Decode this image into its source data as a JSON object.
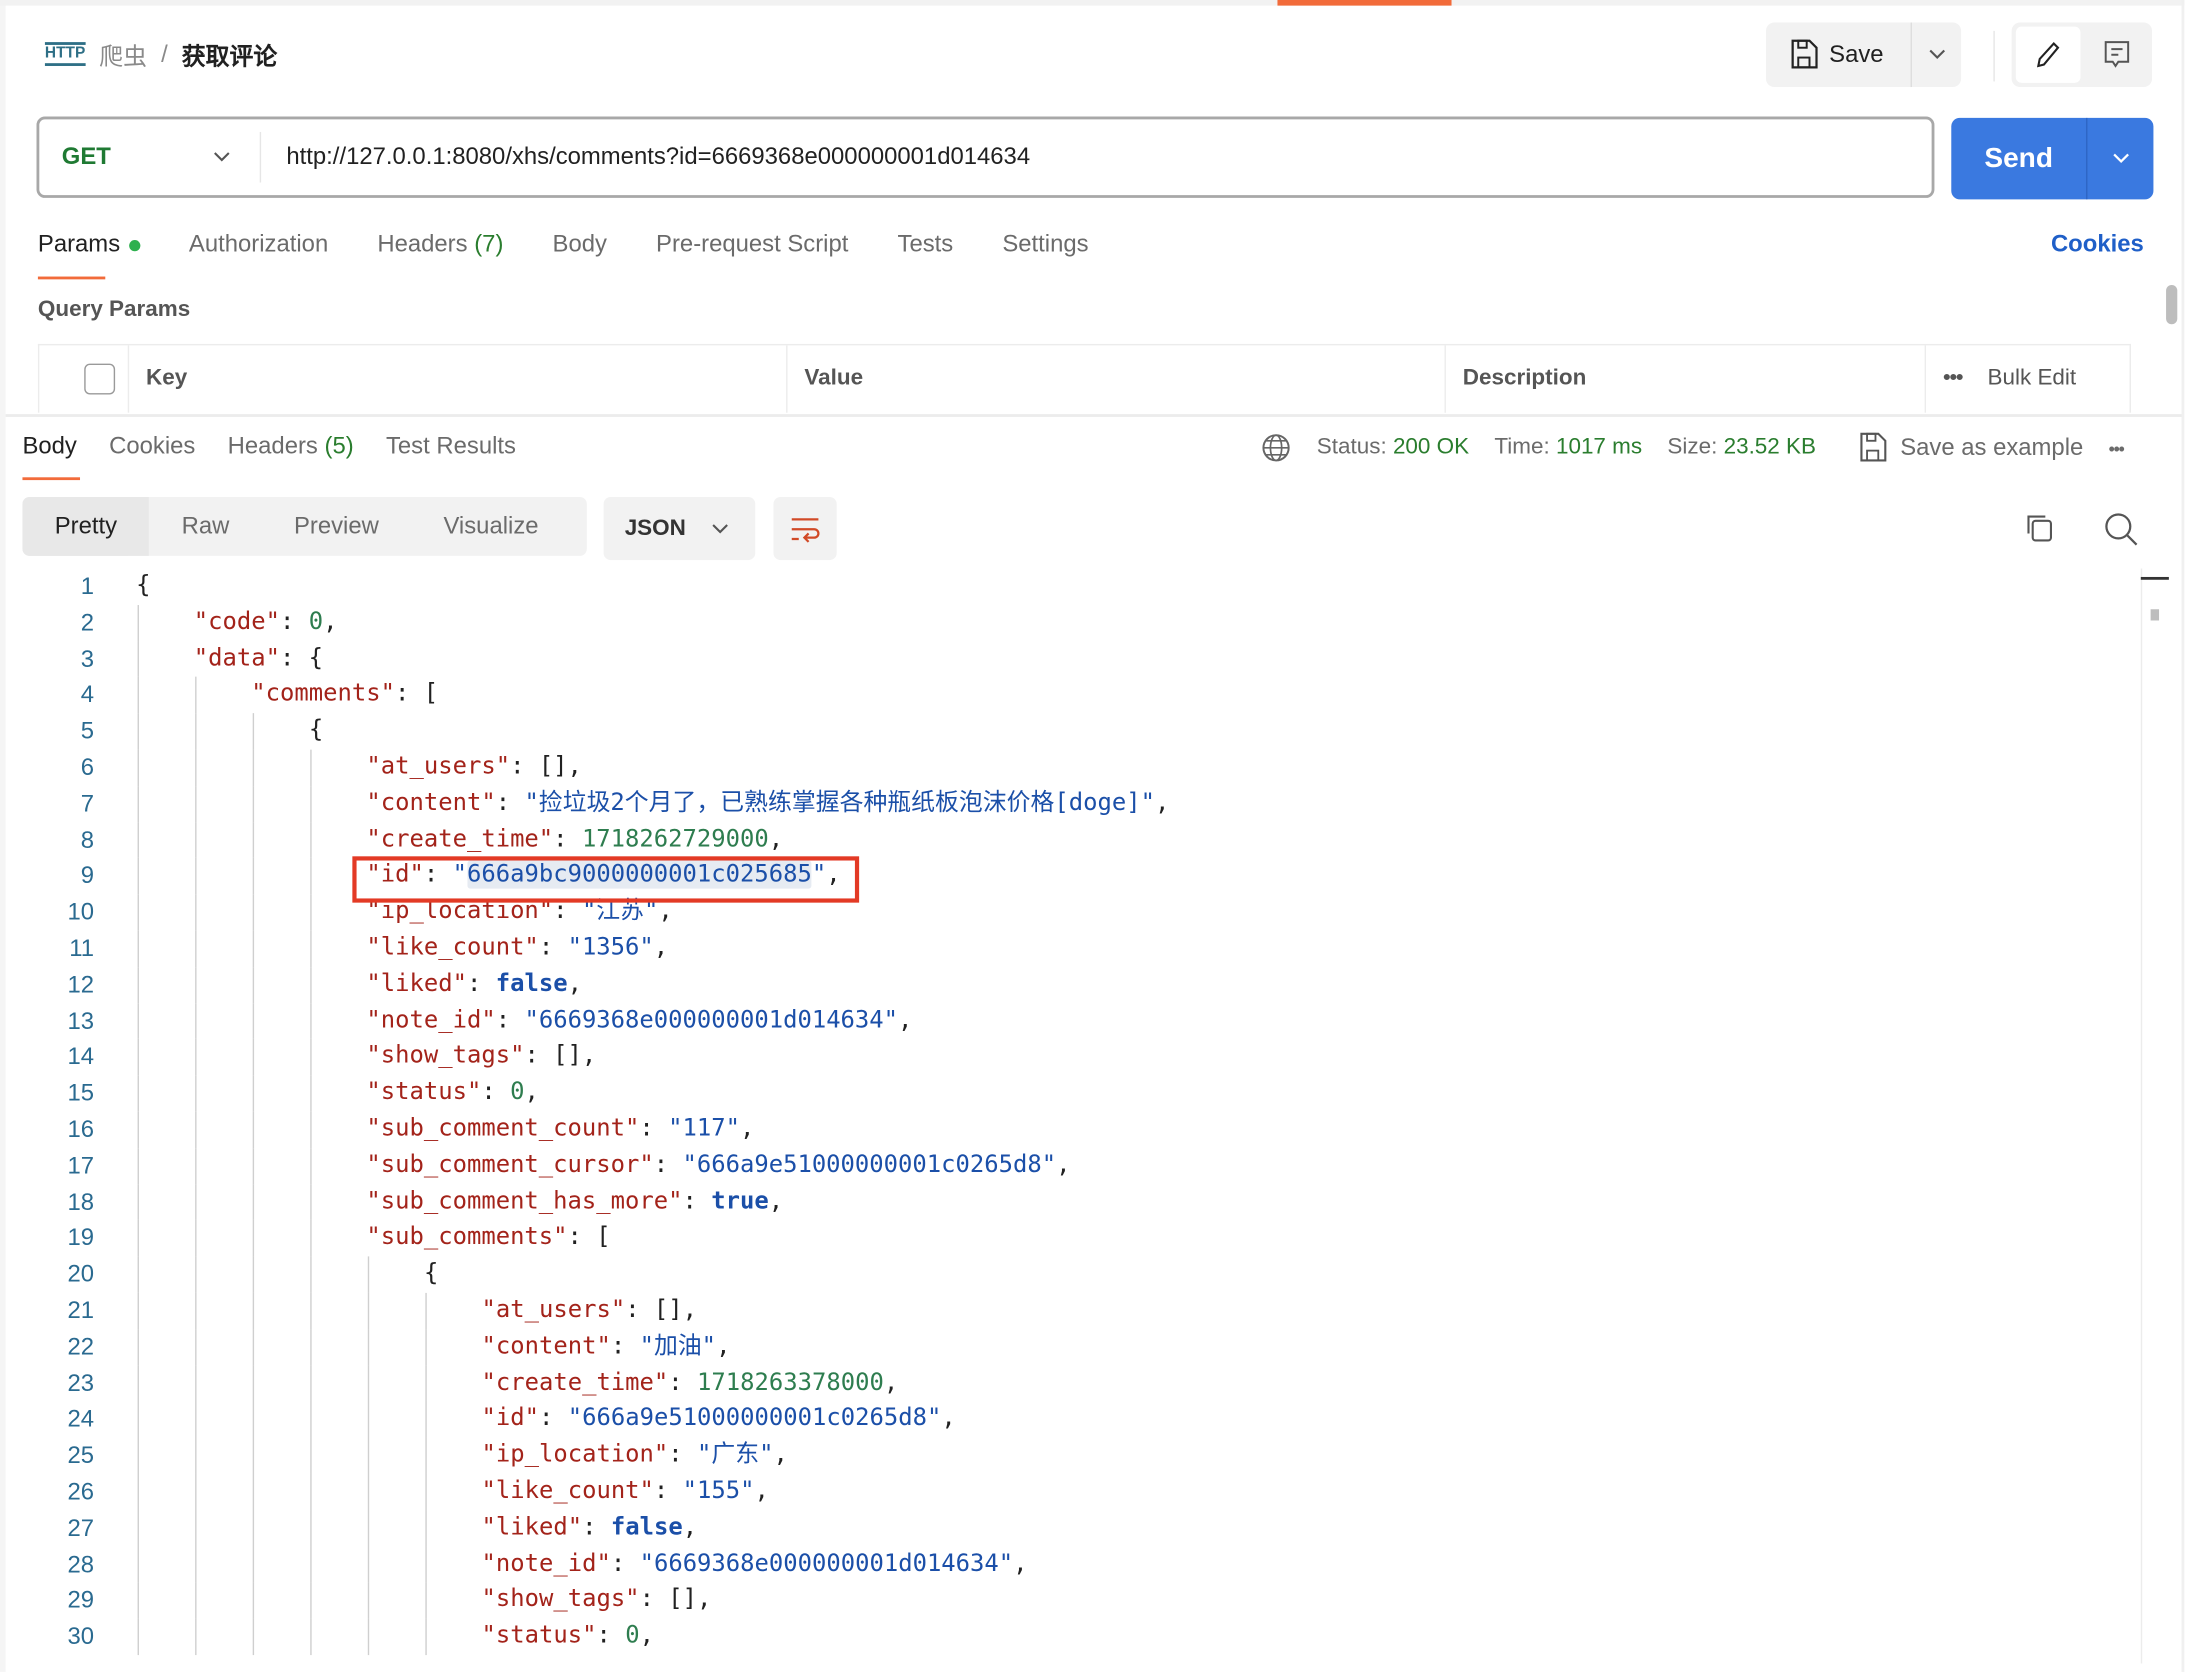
{
  "breadcrumb": {
    "type_icon": "HTTP",
    "collection": "爬虫",
    "separator": "/",
    "request": "获取评论"
  },
  "toolbar": {
    "save_label": "Save"
  },
  "request": {
    "method": "GET",
    "url": "http://127.0.0.1:8080/xhs/comments?id=6669368e000000001d014634",
    "send_label": "Send"
  },
  "request_tabs": [
    {
      "label": "Params",
      "active": true
    },
    {
      "label": "Authorization"
    },
    {
      "label": "Headers",
      "count": "(7)"
    },
    {
      "label": "Body"
    },
    {
      "label": "Pre-request Script"
    },
    {
      "label": "Tests"
    },
    {
      "label": "Settings"
    }
  ],
  "cookies_link": "Cookies",
  "query_params": {
    "title": "Query Params",
    "columns": [
      "Key",
      "Value",
      "Description"
    ],
    "bulk_edit": "Bulk Edit"
  },
  "response_tabs": [
    {
      "label": "Body",
      "active": true
    },
    {
      "label": "Cookies"
    },
    {
      "label": "Headers",
      "count": "(5)"
    },
    {
      "label": "Test Results"
    }
  ],
  "response_meta": {
    "status_label": "Status:",
    "status": "200 OK",
    "time_label": "Time:",
    "time": "1017 ms",
    "size_label": "Size:",
    "size": "23.52 KB",
    "save_example": "Save as example"
  },
  "view_modes": [
    "Pretty",
    "Raw",
    "Preview",
    "Visualize"
  ],
  "format": "JSON",
  "colors": {
    "accent": "#f26b3a",
    "send": "#3a79e0",
    "highlight_box": "#e33a25",
    "key": "#a3231a",
    "string": "#1b4fa8",
    "number": "#2e7d4f"
  },
  "code_lines": [
    {
      "indent": 0,
      "tokens": [
        [
          "p",
          "{"
        ]
      ]
    },
    {
      "indent": 1,
      "tokens": [
        [
          "k",
          "\"code\""
        ],
        [
          "p",
          ": "
        ],
        [
          "n",
          "0"
        ],
        [
          "p",
          ","
        ]
      ]
    },
    {
      "indent": 1,
      "tokens": [
        [
          "k",
          "\"data\""
        ],
        [
          "p",
          ": {"
        ]
      ]
    },
    {
      "indent": 2,
      "tokens": [
        [
          "k",
          "\"comments\""
        ],
        [
          "p",
          ": ["
        ]
      ]
    },
    {
      "indent": 3,
      "tokens": [
        [
          "p",
          "{"
        ]
      ]
    },
    {
      "indent": 4,
      "tokens": [
        [
          "k",
          "\"at_users\""
        ],
        [
          "p",
          ": [],"
        ]
      ]
    },
    {
      "indent": 4,
      "tokens": [
        [
          "k",
          "\"content\""
        ],
        [
          "p",
          ": "
        ],
        [
          "s",
          "\"捡垃圾2个月了，已熟练掌握各种瓶纸板泡沫价格[doge]\""
        ],
        [
          "p",
          ","
        ]
      ]
    },
    {
      "indent": 4,
      "tokens": [
        [
          "k",
          "\"create_time\""
        ],
        [
          "p",
          ": "
        ],
        [
          "n",
          "1718262729000"
        ],
        [
          "p",
          ","
        ]
      ]
    },
    {
      "indent": 4,
      "highlighted": true,
      "tokens": [
        [
          "k",
          "\"id\""
        ],
        [
          "p",
          ": "
        ],
        [
          "s",
          "\""
        ],
        [
          "sel",
          "666a9bc9000000001c025685"
        ],
        [
          "s",
          "\""
        ],
        [
          "p",
          ","
        ]
      ]
    },
    {
      "indent": 4,
      "tokens": [
        [
          "k",
          "\"ip_location\""
        ],
        [
          "p",
          ": "
        ],
        [
          "s",
          "\"江苏\""
        ],
        [
          "p",
          ","
        ]
      ]
    },
    {
      "indent": 4,
      "tokens": [
        [
          "k",
          "\"like_count\""
        ],
        [
          "p",
          ": "
        ],
        [
          "s",
          "\"1356\""
        ],
        [
          "p",
          ","
        ]
      ]
    },
    {
      "indent": 4,
      "tokens": [
        [
          "k",
          "\"liked\""
        ],
        [
          "p",
          ": "
        ],
        [
          "b",
          "false"
        ],
        [
          "p",
          ","
        ]
      ]
    },
    {
      "indent": 4,
      "tokens": [
        [
          "k",
          "\"note_id\""
        ],
        [
          "p",
          ": "
        ],
        [
          "s",
          "\"6669368e000000001d014634\""
        ],
        [
          "p",
          ","
        ]
      ]
    },
    {
      "indent": 4,
      "tokens": [
        [
          "k",
          "\"show_tags\""
        ],
        [
          "p",
          ": [],"
        ]
      ]
    },
    {
      "indent": 4,
      "tokens": [
        [
          "k",
          "\"status\""
        ],
        [
          "p",
          ": "
        ],
        [
          "n",
          "0"
        ],
        [
          "p",
          ","
        ]
      ]
    },
    {
      "indent": 4,
      "tokens": [
        [
          "k",
          "\"sub_comment_count\""
        ],
        [
          "p",
          ": "
        ],
        [
          "s",
          "\"117\""
        ],
        [
          "p",
          ","
        ]
      ]
    },
    {
      "indent": 4,
      "tokens": [
        [
          "k",
          "\"sub_comment_cursor\""
        ],
        [
          "p",
          ": "
        ],
        [
          "s",
          "\"666a9e51000000001c0265d8\""
        ],
        [
          "p",
          ","
        ]
      ]
    },
    {
      "indent": 4,
      "tokens": [
        [
          "k",
          "\"sub_comment_has_more\""
        ],
        [
          "p",
          ": "
        ],
        [
          "b",
          "true"
        ],
        [
          "p",
          ","
        ]
      ]
    },
    {
      "indent": 4,
      "tokens": [
        [
          "k",
          "\"sub_comments\""
        ],
        [
          "p",
          ": ["
        ]
      ]
    },
    {
      "indent": 5,
      "tokens": [
        [
          "p",
          "{"
        ]
      ]
    },
    {
      "indent": 6,
      "tokens": [
        [
          "k",
          "\"at_users\""
        ],
        [
          "p",
          ": [],"
        ]
      ]
    },
    {
      "indent": 6,
      "tokens": [
        [
          "k",
          "\"content\""
        ],
        [
          "p",
          ": "
        ],
        [
          "s",
          "\"加油\""
        ],
        [
          "p",
          ","
        ]
      ]
    },
    {
      "indent": 6,
      "tokens": [
        [
          "k",
          "\"create_time\""
        ],
        [
          "p",
          ": "
        ],
        [
          "n",
          "1718263378000"
        ],
        [
          "p",
          ","
        ]
      ]
    },
    {
      "indent": 6,
      "tokens": [
        [
          "k",
          "\"id\""
        ],
        [
          "p",
          ": "
        ],
        [
          "s",
          "\"666a9e51000000001c0265d8\""
        ],
        [
          "p",
          ","
        ]
      ]
    },
    {
      "indent": 6,
      "tokens": [
        [
          "k",
          "\"ip_location\""
        ],
        [
          "p",
          ": "
        ],
        [
          "s",
          "\"广东\""
        ],
        [
          "p",
          ","
        ]
      ]
    },
    {
      "indent": 6,
      "tokens": [
        [
          "k",
          "\"like_count\""
        ],
        [
          "p",
          ": "
        ],
        [
          "s",
          "\"155\""
        ],
        [
          "p",
          ","
        ]
      ]
    },
    {
      "indent": 6,
      "tokens": [
        [
          "k",
          "\"liked\""
        ],
        [
          "p",
          ": "
        ],
        [
          "b",
          "false"
        ],
        [
          "p",
          ","
        ]
      ]
    },
    {
      "indent": 6,
      "tokens": [
        [
          "k",
          "\"note_id\""
        ],
        [
          "p",
          ": "
        ],
        [
          "s",
          "\"6669368e000000001d014634\""
        ],
        [
          "p",
          ","
        ]
      ]
    },
    {
      "indent": 6,
      "tokens": [
        [
          "k",
          "\"show_tags\""
        ],
        [
          "p",
          ": [],"
        ]
      ]
    },
    {
      "indent": 6,
      "tokens": [
        [
          "k",
          "\"status\""
        ],
        [
          "p",
          ": "
        ],
        [
          "n",
          "0"
        ],
        [
          "p",
          ","
        ]
      ]
    }
  ]
}
